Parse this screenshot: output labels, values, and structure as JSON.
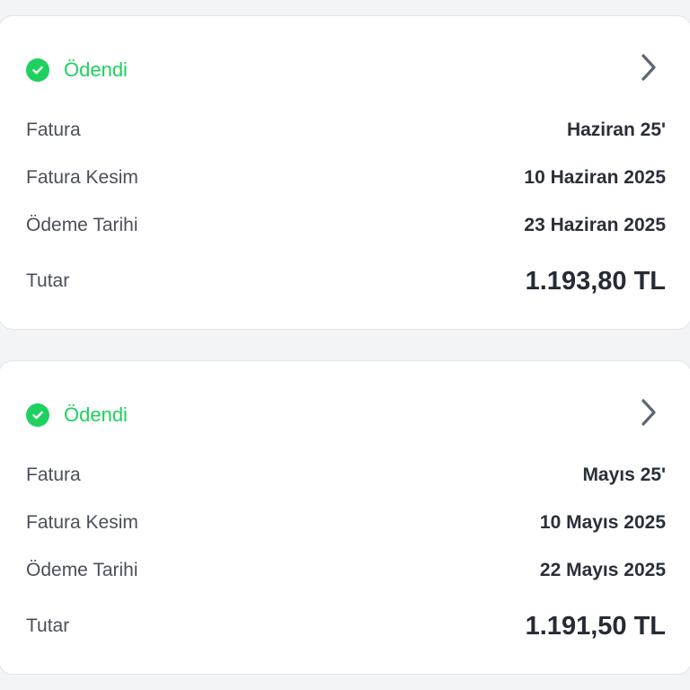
{
  "colors": {
    "paid_green": "#1ed15f",
    "chevron_gray": "#5f6572",
    "background": "#f3f4f6"
  },
  "labels": {
    "invoice": "Fatura",
    "issue_date": "Fatura Kesim",
    "due_date": "Ödeme Tarihi",
    "amount": "Tutar"
  },
  "bills": [
    {
      "status": "Ödendi",
      "status_icon": "check-circle-icon",
      "invoice": "Haziran 25'",
      "issue_date": "10 Haziran 2025",
      "due_date": "23 Haziran 2025",
      "amount": "1.193,80 TL"
    },
    {
      "status": "Ödendi",
      "status_icon": "check-circle-icon",
      "invoice": "Mayıs 25'",
      "issue_date": "10 Mayıs 2025",
      "due_date": "22 Mayıs 2025",
      "amount": "1.191,50 TL"
    }
  ]
}
